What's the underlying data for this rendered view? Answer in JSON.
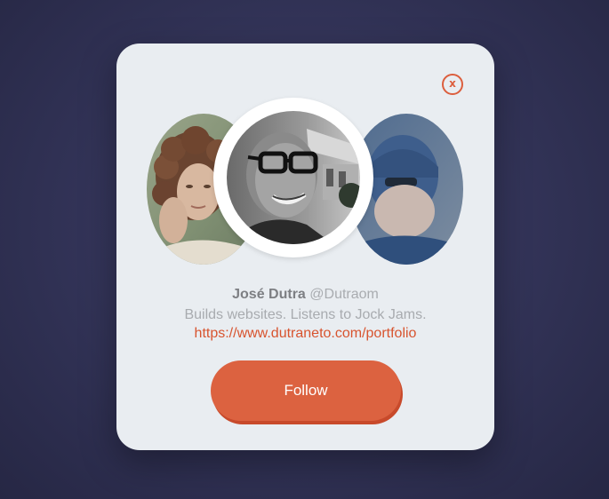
{
  "profile": {
    "name": "José Dutra",
    "handle": "@Dutraom",
    "bio": "Builds websites. Listens to Jock Jams.",
    "link": "https://www.dutraneto.com/portfolio"
  },
  "actions": {
    "follow_label": "Follow",
    "close_label": "x"
  },
  "colors": {
    "accent": "#dc6240",
    "link": "#d8542f",
    "card_background": "#e9edf1",
    "page_background": "#34355a"
  },
  "avatars": [
    {
      "role": "left",
      "icon": "person-photo-icon"
    },
    {
      "role": "main",
      "icon": "person-photo-icon"
    },
    {
      "role": "right",
      "icon": "person-photo-icon"
    }
  ]
}
